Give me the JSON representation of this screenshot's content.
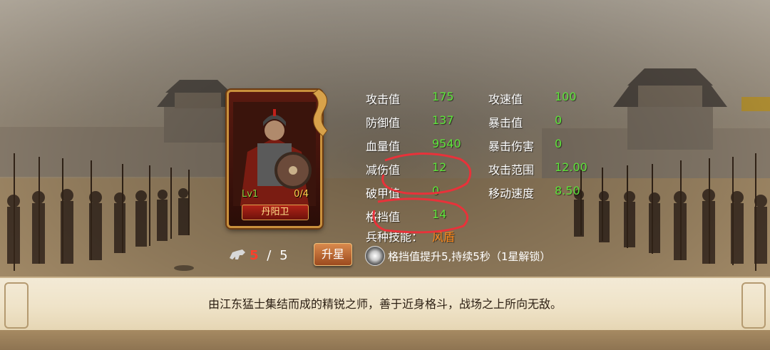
{
  "hero": {
    "name": "丹阳卫",
    "level": "Lv1",
    "fragments": "0/4"
  },
  "stats": {
    "left": [
      {
        "label": "攻击值",
        "value": "175"
      },
      {
        "label": "防御值",
        "value": "137"
      },
      {
        "label": "血量值",
        "value": "9540"
      },
      {
        "label": "减伤值",
        "value": "12"
      },
      {
        "label": "破甲值",
        "value": "0"
      },
      {
        "label": "格挡值",
        "value": "14"
      }
    ],
    "right": [
      {
        "label": "攻速值",
        "value": "100"
      },
      {
        "label": "暴击值",
        "value": "0"
      },
      {
        "label": "暴击伤害",
        "value": "0"
      },
      {
        "label": "攻击范围",
        "value": "12.00"
      },
      {
        "label": "移动速度",
        "value": "8.50"
      }
    ],
    "skill": {
      "label": "兵种技能：",
      "value": "风盾"
    }
  },
  "star": {
    "current": "5",
    "separator": "/",
    "max": "5"
  },
  "upgrade": {
    "label": "升星"
  },
  "skill_desc": "格挡值提升5,持续5秒（1星解锁）",
  "description": "由江东猛士集结而成的精锐之师，善于近身格斗，战场之上所向无敌。",
  "colors": {
    "stat_value": "#5de33a",
    "skill_value": "#ff8a1c",
    "annotation": "#e8323a",
    "star_current": "#ff3e2a"
  }
}
